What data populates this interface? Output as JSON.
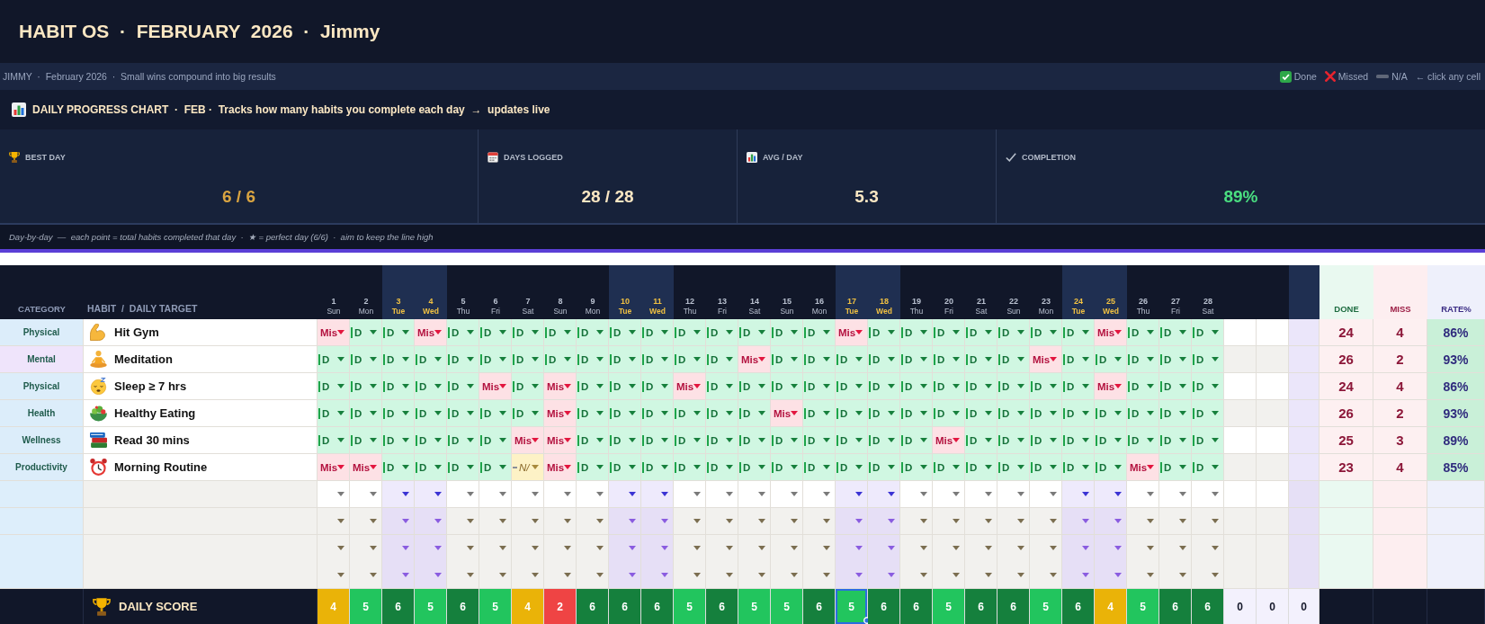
{
  "header": {
    "title": "HABIT OS  ·  FEBRUARY  2026  ·  Jimmy"
  },
  "info_bar": {
    "text": "JIMMY  ·  February 2026  ·  Small wins compound into big results",
    "legend": [
      {
        "kind": "done",
        "label": "Done"
      },
      {
        "kind": "missed",
        "label": "Missed"
      },
      {
        "kind": "na",
        "label": "N/A"
      },
      {
        "kind": "hint",
        "label": "← click any cell"
      }
    ]
  },
  "progress_panel": {
    "title": "DAILY PROGRESS CHART  ·  FEB ·  Tracks how many habits you complete each day  →  updates live",
    "stats": [
      {
        "label": "BEST DAY",
        "value": "6 / 6",
        "color": "#d9a441"
      },
      {
        "label": "DAYS LOGGED",
        "value": "28 / 28",
        "color": "#fbe7c3"
      },
      {
        "label": "AVG / DAY",
        "value": "5.3",
        "color": "#fbe7c3"
      },
      {
        "label": "COMPLETION",
        "value": "89%",
        "color": "#4ade80"
      }
    ],
    "note": "Day-by-day  —  each point = total habits completed that day  ·  ★ = perfect day (6/6)  ·  aim to keep the line high"
  },
  "table": {
    "columns": {
      "category": "CATEGORY",
      "habit": "HABIT  /  DAILY TARGET",
      "done": "DONE",
      "miss": "MISS",
      "rate": "RATE%"
    },
    "days": [
      {
        "number": "1",
        "weekday": "Sun",
        "highlighted": false
      },
      {
        "number": "2",
        "weekday": "Mon",
        "highlighted": false
      },
      {
        "number": "3",
        "weekday": "Tue",
        "highlighted": true
      },
      {
        "number": "4",
        "weekday": "Wed",
        "highlighted": true
      },
      {
        "number": "5",
        "weekday": "Thu",
        "highlighted": false
      },
      {
        "number": "6",
        "weekday": "Fri",
        "highlighted": false
      },
      {
        "number": "7",
        "weekday": "Sat",
        "highlighted": false
      },
      {
        "number": "8",
        "weekday": "Sun",
        "highlighted": false
      },
      {
        "number": "9",
        "weekday": "Mon",
        "highlighted": false
      },
      {
        "number": "10",
        "weekday": "Tue",
        "highlighted": true
      },
      {
        "number": "11",
        "weekday": "Wed",
        "highlighted": true
      },
      {
        "number": "12",
        "weekday": "Thu",
        "highlighted": false
      },
      {
        "number": "13",
        "weekday": "Fri",
        "highlighted": false
      },
      {
        "number": "14",
        "weekday": "Sat",
        "highlighted": false
      },
      {
        "number": "15",
        "weekday": "Sun",
        "highlighted": false
      },
      {
        "number": "16",
        "weekday": "Mon",
        "highlighted": false
      },
      {
        "number": "17",
        "weekday": "Tue",
        "highlighted": true
      },
      {
        "number": "18",
        "weekday": "Wed",
        "highlighted": true
      },
      {
        "number": "19",
        "weekday": "Thu",
        "highlighted": false
      },
      {
        "number": "20",
        "weekday": "Fri",
        "highlighted": false
      },
      {
        "number": "21",
        "weekday": "Sat",
        "highlighted": false
      },
      {
        "number": "22",
        "weekday": "Sun",
        "highlighted": false
      },
      {
        "number": "23",
        "weekday": "Mon",
        "highlighted": false
      },
      {
        "number": "24",
        "weekday": "Tue",
        "highlighted": true
      },
      {
        "number": "25",
        "weekday": "Wed",
        "highlighted": true
      },
      {
        "number": "26",
        "weekday": "Thu",
        "highlighted": false
      },
      {
        "number": "27",
        "weekday": "Fri",
        "highlighted": false
      },
      {
        "number": "28",
        "weekday": "Sat",
        "highlighted": false
      }
    ],
    "habits": [
      {
        "category": {
          "label": "Physical",
          "color": "#dcedfa"
        },
        "name": "Hit Gym",
        "cells": [
          {
            "kind": "missed",
            "text": "Mis"
          },
          {
            "kind": "done",
            "text": "D"
          },
          {
            "kind": "done",
            "text": "D"
          },
          {
            "kind": "missed",
            "text": "Mis"
          },
          {
            "kind": "done",
            "text": "D"
          },
          {
            "kind": "done",
            "text": "D"
          },
          {
            "kind": "done",
            "text": "D"
          },
          {
            "kind": "done",
            "text": "D"
          },
          {
            "kind": "done",
            "text": "D"
          },
          {
            "kind": "done",
            "text": "D"
          },
          {
            "kind": "done",
            "text": "D"
          },
          {
            "kind": "done",
            "text": "D"
          },
          {
            "kind": "done",
            "text": "D"
          },
          {
            "kind": "done",
            "text": "D"
          },
          {
            "kind": "done",
            "text": "D"
          },
          {
            "kind": "done",
            "text": "D"
          },
          {
            "kind": "missed",
            "text": "Mis"
          },
          {
            "kind": "done",
            "text": "D"
          },
          {
            "kind": "done",
            "text": "D"
          },
          {
            "kind": "done",
            "text": "D"
          },
          {
            "kind": "done",
            "text": "D"
          },
          {
            "kind": "done",
            "text": "D"
          },
          {
            "kind": "done",
            "text": "D"
          },
          {
            "kind": "done",
            "text": "D"
          },
          {
            "kind": "missed",
            "text": "Mis"
          },
          {
            "kind": "done",
            "text": "D"
          },
          {
            "kind": "done",
            "text": "D"
          },
          {
            "kind": "done",
            "text": "D"
          }
        ],
        "done": "24",
        "miss": "4",
        "rate": "86%"
      },
      {
        "category": {
          "label": "Mental",
          "color": "#efe4fb"
        },
        "name": "Meditation",
        "cells": [
          {
            "kind": "done",
            "text": "D"
          },
          {
            "kind": "done",
            "text": "D"
          },
          {
            "kind": "done",
            "text": "D"
          },
          {
            "kind": "done",
            "text": "D"
          },
          {
            "kind": "done",
            "text": "D"
          },
          {
            "kind": "done",
            "text": "D"
          },
          {
            "kind": "done",
            "text": "D"
          },
          {
            "kind": "done",
            "text": "D"
          },
          {
            "kind": "done",
            "text": "D"
          },
          {
            "kind": "done",
            "text": "D"
          },
          {
            "kind": "done",
            "text": "D"
          },
          {
            "kind": "done",
            "text": "D"
          },
          {
            "kind": "done",
            "text": "D"
          },
          {
            "kind": "missed",
            "text": "Mis"
          },
          {
            "kind": "done",
            "text": "D"
          },
          {
            "kind": "done",
            "text": "D"
          },
          {
            "kind": "done",
            "text": "D"
          },
          {
            "kind": "done",
            "text": "D"
          },
          {
            "kind": "done",
            "text": "D"
          },
          {
            "kind": "done",
            "text": "D"
          },
          {
            "kind": "done",
            "text": "D"
          },
          {
            "kind": "done",
            "text": "D"
          },
          {
            "kind": "missed",
            "text": "Mis"
          },
          {
            "kind": "done",
            "text": "D"
          },
          {
            "kind": "done",
            "text": "D"
          },
          {
            "kind": "done",
            "text": "D"
          },
          {
            "kind": "done",
            "text": "D"
          },
          {
            "kind": "done",
            "text": "D"
          }
        ],
        "done": "26",
        "miss": "2",
        "rate": "93%"
      },
      {
        "category": {
          "label": "Physical",
          "color": "#dcedfa"
        },
        "name": "Sleep ≥ 7 hrs",
        "cells": [
          {
            "kind": "done",
            "text": "D"
          },
          {
            "kind": "done",
            "text": "D"
          },
          {
            "kind": "done",
            "text": "D"
          },
          {
            "kind": "done",
            "text": "D"
          },
          {
            "kind": "done",
            "text": "D"
          },
          {
            "kind": "missed",
            "text": "Mis"
          },
          {
            "kind": "done",
            "text": "D"
          },
          {
            "kind": "missed",
            "text": "Mis"
          },
          {
            "kind": "done",
            "text": "D"
          },
          {
            "kind": "done",
            "text": "D"
          },
          {
            "kind": "done",
            "text": "D"
          },
          {
            "kind": "missed",
            "text": "Mis"
          },
          {
            "kind": "done",
            "text": "D"
          },
          {
            "kind": "done",
            "text": "D"
          },
          {
            "kind": "done",
            "text": "D"
          },
          {
            "kind": "done",
            "text": "D"
          },
          {
            "kind": "done",
            "text": "D"
          },
          {
            "kind": "done",
            "text": "D"
          },
          {
            "kind": "done",
            "text": "D"
          },
          {
            "kind": "done",
            "text": "D"
          },
          {
            "kind": "done",
            "text": "D"
          },
          {
            "kind": "done",
            "text": "D"
          },
          {
            "kind": "done",
            "text": "D"
          },
          {
            "kind": "done",
            "text": "D"
          },
          {
            "kind": "missed",
            "text": "Mis"
          },
          {
            "kind": "done",
            "text": "D"
          },
          {
            "kind": "done",
            "text": "D"
          },
          {
            "kind": "done",
            "text": "D"
          }
        ],
        "done": "24",
        "miss": "4",
        "rate": "86%"
      },
      {
        "category": {
          "label": "Health",
          "color": "#dcedfa"
        },
        "name": "Healthy Eating",
        "cells": [
          {
            "kind": "done",
            "text": "D"
          },
          {
            "kind": "done",
            "text": "D"
          },
          {
            "kind": "done",
            "text": "D"
          },
          {
            "kind": "done",
            "text": "D"
          },
          {
            "kind": "done",
            "text": "D"
          },
          {
            "kind": "done",
            "text": "D"
          },
          {
            "kind": "done",
            "text": "D"
          },
          {
            "kind": "missed",
            "text": "Mis"
          },
          {
            "kind": "done",
            "text": "D"
          },
          {
            "kind": "done",
            "text": "D"
          },
          {
            "kind": "done",
            "text": "D"
          },
          {
            "kind": "done",
            "text": "D"
          },
          {
            "kind": "done",
            "text": "D"
          },
          {
            "kind": "done",
            "text": "D"
          },
          {
            "kind": "missed",
            "text": "Mis"
          },
          {
            "kind": "done",
            "text": "D"
          },
          {
            "kind": "done",
            "text": "D"
          },
          {
            "kind": "done",
            "text": "D"
          },
          {
            "kind": "done",
            "text": "D"
          },
          {
            "kind": "done",
            "text": "D"
          },
          {
            "kind": "done",
            "text": "D"
          },
          {
            "kind": "done",
            "text": "D"
          },
          {
            "kind": "done",
            "text": "D"
          },
          {
            "kind": "done",
            "text": "D"
          },
          {
            "kind": "done",
            "text": "D"
          },
          {
            "kind": "done",
            "text": "D"
          },
          {
            "kind": "done",
            "text": "D"
          },
          {
            "kind": "done",
            "text": "D"
          }
        ],
        "done": "26",
        "miss": "2",
        "rate": "93%"
      },
      {
        "category": {
          "label": "Wellness",
          "color": "#dcedfa"
        },
        "name": "Read 30 mins",
        "cells": [
          {
            "kind": "done",
            "text": "D"
          },
          {
            "kind": "done",
            "text": "D"
          },
          {
            "kind": "done",
            "text": "D"
          },
          {
            "kind": "done",
            "text": "D"
          },
          {
            "kind": "done",
            "text": "D"
          },
          {
            "kind": "done",
            "text": "D"
          },
          {
            "kind": "missed",
            "text": "Mis"
          },
          {
            "kind": "missed",
            "text": "Mis"
          },
          {
            "kind": "done",
            "text": "D"
          },
          {
            "kind": "done",
            "text": "D"
          },
          {
            "kind": "done",
            "text": "D"
          },
          {
            "kind": "done",
            "text": "D"
          },
          {
            "kind": "done",
            "text": "D"
          },
          {
            "kind": "done",
            "text": "D"
          },
          {
            "kind": "done",
            "text": "D"
          },
          {
            "kind": "done",
            "text": "D"
          },
          {
            "kind": "done",
            "text": "D"
          },
          {
            "kind": "done",
            "text": "D"
          },
          {
            "kind": "done",
            "text": "D"
          },
          {
            "kind": "missed",
            "text": "Mis"
          },
          {
            "kind": "done",
            "text": "D"
          },
          {
            "kind": "done",
            "text": "D"
          },
          {
            "kind": "done",
            "text": "D"
          },
          {
            "kind": "done",
            "text": "D"
          },
          {
            "kind": "done",
            "text": "D"
          },
          {
            "kind": "done",
            "text": "D"
          },
          {
            "kind": "done",
            "text": "D"
          },
          {
            "kind": "done",
            "text": "D"
          }
        ],
        "done": "25",
        "miss": "3",
        "rate": "89%"
      },
      {
        "category": {
          "label": "Productivity",
          "color": "#dcedfa"
        },
        "name": "Morning Routine",
        "cells": [
          {
            "kind": "missed",
            "text": "Mis"
          },
          {
            "kind": "missed",
            "text": "Mis"
          },
          {
            "kind": "done",
            "text": "D"
          },
          {
            "kind": "done",
            "text": "D"
          },
          {
            "kind": "done",
            "text": "D"
          },
          {
            "kind": "done",
            "text": "D"
          },
          {
            "kind": "na",
            "text": "N/"
          },
          {
            "kind": "missed",
            "text": "Mis"
          },
          {
            "kind": "done",
            "text": "D"
          },
          {
            "kind": "done",
            "text": "D"
          },
          {
            "kind": "done",
            "text": "D"
          },
          {
            "kind": "done",
            "text": "D"
          },
          {
            "kind": "done",
            "text": "D"
          },
          {
            "kind": "done",
            "text": "D"
          },
          {
            "kind": "done",
            "text": "D"
          },
          {
            "kind": "done",
            "text": "D"
          },
          {
            "kind": "done",
            "text": "D"
          },
          {
            "kind": "done",
            "text": "D"
          },
          {
            "kind": "done",
            "text": "D"
          },
          {
            "kind": "done",
            "text": "D"
          },
          {
            "kind": "done",
            "text": "D"
          },
          {
            "kind": "done",
            "text": "D"
          },
          {
            "kind": "done",
            "text": "D"
          },
          {
            "kind": "done",
            "text": "D"
          },
          {
            "kind": "done",
            "text": "D"
          },
          {
            "kind": "missed",
            "text": "Mis"
          },
          {
            "kind": "done",
            "text": "D"
          },
          {
            "kind": "done",
            "text": "D"
          }
        ],
        "done": "23",
        "miss": "4",
        "rate": "85%"
      }
    ],
    "blank_rows": [
      {
        "kind": "plain"
      },
      {
        "kind": "shaded"
      },
      {
        "kind": "tall"
      }
    ],
    "score_row": {
      "label": "DAILY SCORE",
      "scores": [
        {
          "value": "4",
          "color": "#eab308",
          "selected": false
        },
        {
          "value": "5",
          "color": "#22c55e",
          "selected": false
        },
        {
          "value": "6",
          "color": "#15803d",
          "selected": false
        },
        {
          "value": "5",
          "color": "#22c55e",
          "selected": false
        },
        {
          "value": "6",
          "color": "#15803d",
          "selected": false
        },
        {
          "value": "5",
          "color": "#22c55e",
          "selected": false
        },
        {
          "value": "4",
          "color": "#eab308",
          "selected": false
        },
        {
          "value": "2",
          "color": "#ef4444",
          "selected": false
        },
        {
          "value": "6",
          "color": "#15803d",
          "selected": false
        },
        {
          "value": "6",
          "color": "#15803d",
          "selected": false
        },
        {
          "value": "6",
          "color": "#15803d",
          "selected": false
        },
        {
          "value": "5",
          "color": "#22c55e",
          "selected": false
        },
        {
          "value": "6",
          "color": "#15803d",
          "selected": false
        },
        {
          "value": "5",
          "color": "#22c55e",
          "selected": false
        },
        {
          "value": "5",
          "color": "#22c55e",
          "selected": false
        },
        {
          "value": "6",
          "color": "#15803d",
          "selected": false
        },
        {
          "value": "5",
          "color": "#22c55e",
          "selected": true
        },
        {
          "value": "6",
          "color": "#15803d",
          "selected": false
        },
        {
          "value": "6",
          "color": "#15803d",
          "selected": false
        },
        {
          "value": "5",
          "color": "#22c55e",
          "selected": false
        },
        {
          "value": "6",
          "color": "#15803d",
          "selected": false
        },
        {
          "value": "6",
          "color": "#15803d",
          "selected": false
        },
        {
          "value": "5",
          "color": "#22c55e",
          "selected": false
        },
        {
          "value": "6",
          "color": "#15803d",
          "selected": false
        },
        {
          "value": "4",
          "color": "#eab308",
          "selected": false
        },
        {
          "value": "5",
          "color": "#22c55e",
          "selected": false
        },
        {
          "value": "6",
          "color": "#15803d",
          "selected": false
        },
        {
          "value": "6",
          "color": "#15803d",
          "selected": false
        }
      ],
      "extra_scores": [
        "0",
        "0",
        "0"
      ]
    }
  }
}
